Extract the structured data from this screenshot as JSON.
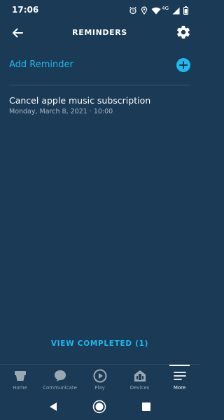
{
  "status_bar": {
    "time": "17:06",
    "network": "4G"
  },
  "header": {
    "title": "REMINDERS"
  },
  "add_reminder": {
    "label": "Add Reminder"
  },
  "reminders": [
    {
      "title": "Cancel apple music subscription",
      "date": "Monday, March 8, 2021 · 10:00"
    }
  ],
  "view_completed": {
    "label": "VIEW COMPLETED (1)"
  },
  "bottom_nav": {
    "items": [
      {
        "label": "Home",
        "icon": "home-icon"
      },
      {
        "label": "Communicate",
        "icon": "chat-bubble-icon"
      },
      {
        "label": "Play",
        "icon": "play-icon"
      },
      {
        "label": "Devices",
        "icon": "devices-icon"
      },
      {
        "label": "More",
        "icon": "menu-icon",
        "active": true
      }
    ]
  },
  "colors": {
    "background": "#1a3a55",
    "accent": "#1fb8ef",
    "text_primary": "#ffffff",
    "text_secondary": "#aab8c4",
    "divider": "#3a5870"
  }
}
